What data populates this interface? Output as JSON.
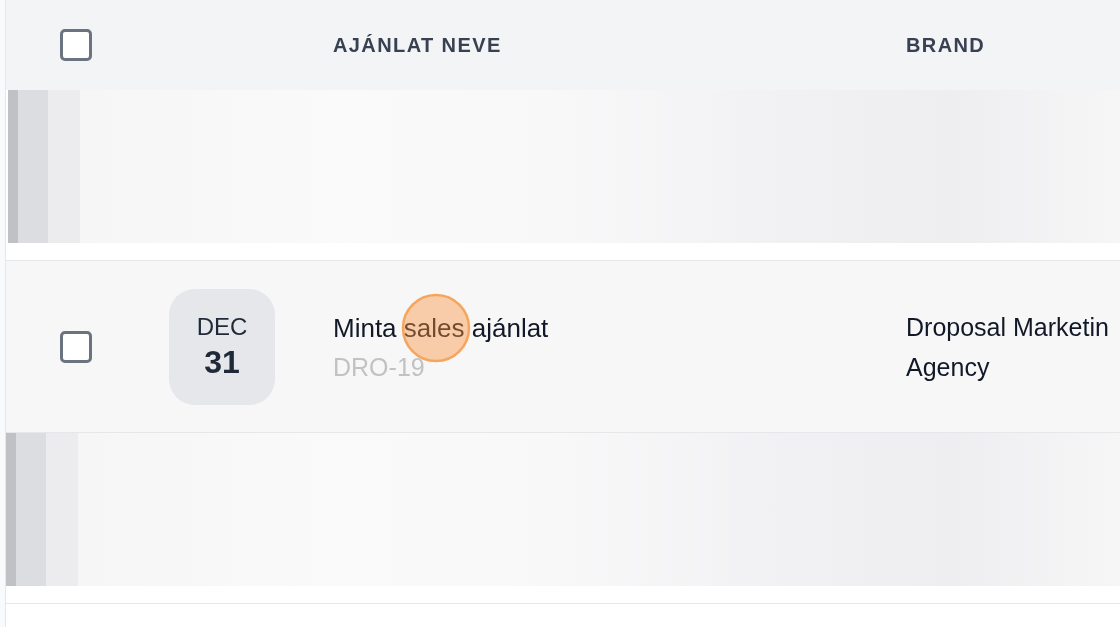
{
  "table": {
    "header": {
      "checked": false,
      "columns": [
        "AJÁNLAT NEVE",
        "BRAND"
      ]
    },
    "rows": [
      {
        "kind": "redacted"
      },
      {
        "kind": "offer",
        "checked": false,
        "click_indicator": true,
        "date": {
          "month": "DEC",
          "day": "31"
        },
        "name": "Minta sales ajánlat",
        "code": "DRO-19",
        "brand": "Droposal Marketin Agency"
      },
      {
        "kind": "redacted"
      }
    ]
  }
}
